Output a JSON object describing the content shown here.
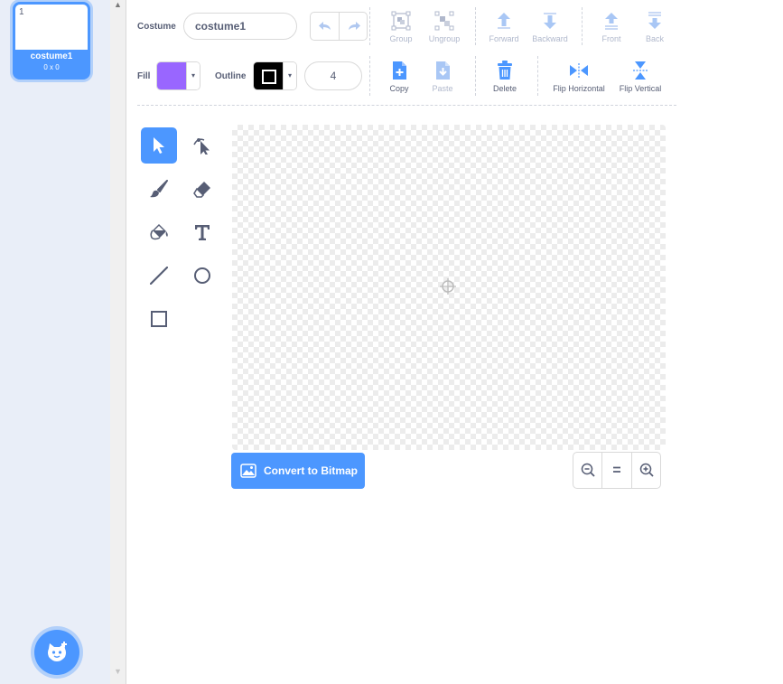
{
  "costume_list": {
    "items": [
      {
        "number": "1",
        "name": "costume1",
        "size": "0 x 0",
        "selected": true
      }
    ],
    "add_button_icon": "add-costume-cat-icon"
  },
  "toolbar": {
    "costume_label": "Costume",
    "costume_name": "costume1",
    "undo_icon": "undo-icon",
    "redo_icon": "redo-icon",
    "group_label": "Group",
    "ungroup_label": "Ungroup",
    "forward_label": "Forward",
    "backward_label": "Backward",
    "front_label": "Front",
    "back_label": "Back",
    "fill_label": "Fill",
    "fill_color": "#9966ff",
    "outline_label": "Outline",
    "outline_color": "#000000",
    "outline_width": "4",
    "copy_label": "Copy",
    "paste_label": "Paste",
    "delete_label": "Delete",
    "flip_horizontal_label": "Flip Horizontal",
    "flip_vertical_label": "Flip Vertical"
  },
  "tools": [
    {
      "name": "select",
      "icon": "select-arrow-icon",
      "active": true
    },
    {
      "name": "reshape",
      "icon": "reshape-icon",
      "active": false
    },
    {
      "name": "brush",
      "icon": "brush-icon",
      "active": false
    },
    {
      "name": "eraser",
      "icon": "eraser-icon",
      "active": false
    },
    {
      "name": "fill",
      "icon": "paint-bucket-icon",
      "active": false
    },
    {
      "name": "text",
      "icon": "text-icon",
      "active": false
    },
    {
      "name": "line",
      "icon": "line-icon",
      "active": false
    },
    {
      "name": "circle",
      "icon": "circle-icon",
      "active": false
    },
    {
      "name": "rectangle",
      "icon": "rectangle-icon",
      "active": false
    }
  ],
  "canvas": {
    "center_icon": "crosshair-icon"
  },
  "bottom_bar": {
    "convert_label": "Convert to Bitmap",
    "zoom_out_icon": "zoom-out-icon",
    "zoom_reset_icon": "zoom-reset-icon",
    "zoom_in_icon": "zoom-in-icon"
  },
  "colors": {
    "accent": "#4c97ff",
    "text": "#575e75",
    "disabled_text": "#b0b8cc",
    "sidebar_bg": "#e9eef8"
  }
}
